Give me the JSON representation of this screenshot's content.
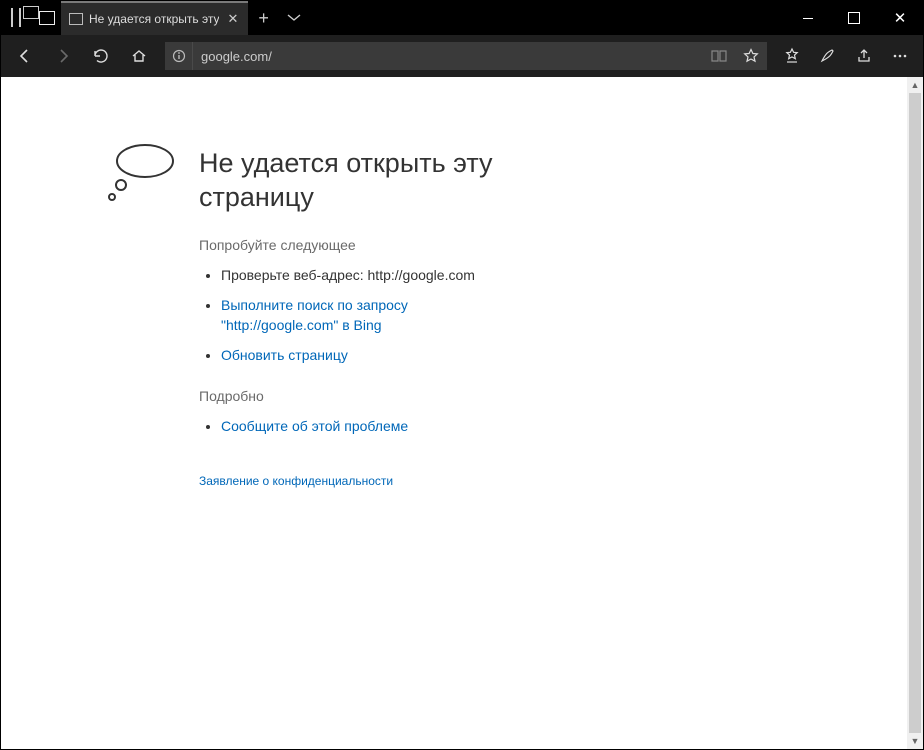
{
  "tab": {
    "title": "Не удается открыть эту"
  },
  "address": {
    "url": "google.com/"
  },
  "error": {
    "heading": "Не удается открыть эту страницу",
    "try_label": "Попробуйте следующее",
    "suggestions": {
      "check_address": "Проверьте веб-адрес: http://google.com",
      "search_bing": "Выполните поиск по запросу \"http://google.com\" в Bing",
      "refresh": "Обновить страницу"
    },
    "details_label": "Подробно",
    "report_problem": "Сообщите об этой проблеме",
    "privacy_statement": "Заявление о конфиденциальности"
  }
}
